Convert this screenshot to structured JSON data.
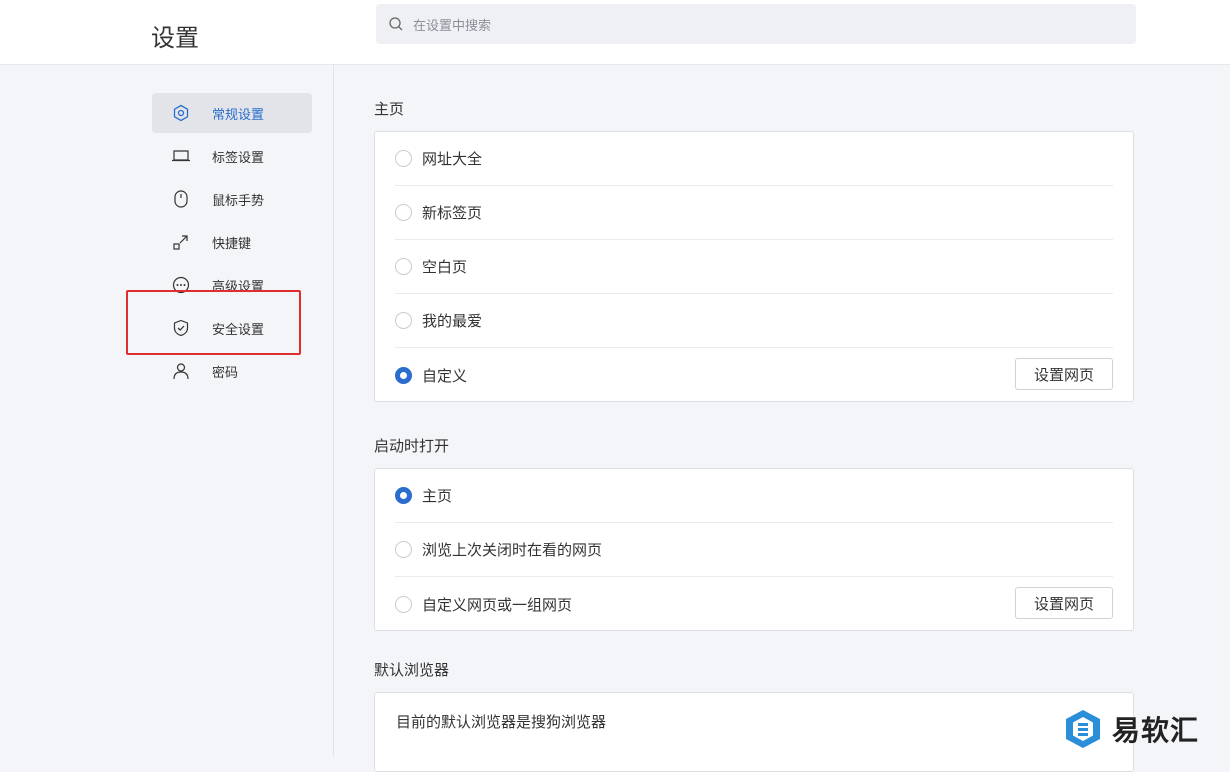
{
  "header": {
    "title": "设置",
    "search_placeholder": "在设置中搜索"
  },
  "sidebar": {
    "items": [
      {
        "label": "常规设置",
        "icon": "hexagon-icon",
        "active": true
      },
      {
        "label": "标签设置",
        "icon": "tab-icon",
        "active": false
      },
      {
        "label": "鼠标手势",
        "icon": "mouse-icon",
        "active": false
      },
      {
        "label": "快捷键",
        "icon": "shortcut-arrow-icon",
        "active": false
      },
      {
        "label": "高级设置",
        "icon": "more-dots-icon",
        "active": false
      },
      {
        "label": "安全设置",
        "icon": "shield-icon",
        "active": false
      },
      {
        "label": "密码",
        "icon": "user-icon",
        "active": false
      }
    ]
  },
  "sections": {
    "homepage": {
      "title": "主页",
      "options": [
        {
          "label": "网址大全",
          "checked": false
        },
        {
          "label": "新标签页",
          "checked": false
        },
        {
          "label": "空白页",
          "checked": false
        },
        {
          "label": "我的最爱",
          "checked": false
        },
        {
          "label": "自定义",
          "checked": true,
          "button": "设置网页"
        }
      ]
    },
    "startup": {
      "title": "启动时打开",
      "options": [
        {
          "label": "主页",
          "checked": true
        },
        {
          "label": "浏览上次关闭时在看的网页",
          "checked": false
        },
        {
          "label": "自定义网页或一组网页",
          "checked": false,
          "button": "设置网页"
        }
      ]
    },
    "default_browser": {
      "title": "默认浏览器",
      "text": "目前的默认浏览器是搜狗浏览器"
    }
  },
  "watermark": {
    "text": "易软汇",
    "logo_icon": "yiruanhui-logo-icon"
  },
  "colors": {
    "accent": "#2a6dcc",
    "highlight_border": "#e02d2d",
    "background": "#f4f5f8"
  }
}
